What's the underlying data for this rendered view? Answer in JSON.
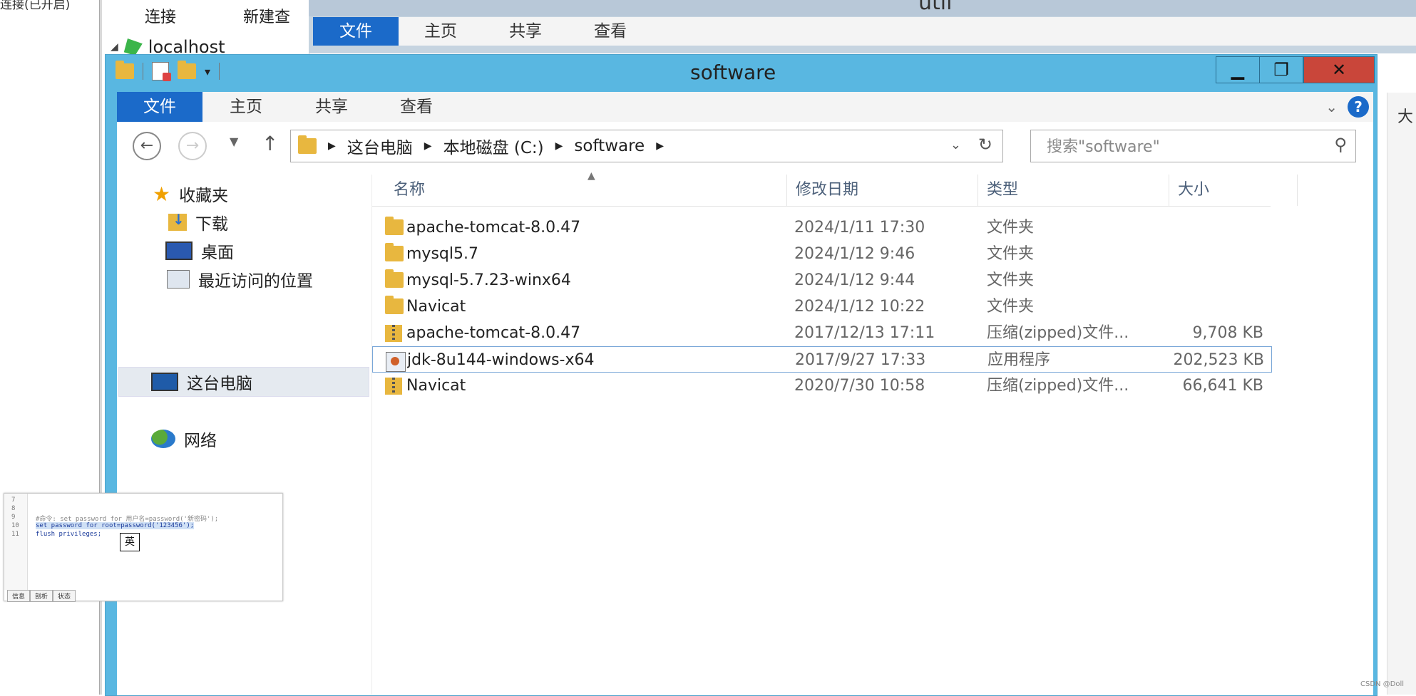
{
  "background": {
    "left_text": "连接(已开启)",
    "navicat": {
      "toolbar": [
        "连接",
        "新建查"
      ],
      "tree_root": "localhost"
    },
    "window": {
      "title": "util",
      "tabs": [
        "文件",
        "主页",
        "共享",
        "查看"
      ]
    },
    "right_edge_text": "大"
  },
  "window": {
    "title": "software",
    "controls": {
      "minimize": "▁",
      "maximize": "❐",
      "close": "✕"
    },
    "ribbon_tabs": [
      "文件",
      "主页",
      "共享",
      "查看"
    ],
    "help_glyph": "?",
    "address": {
      "crumbs": [
        "这台电脑",
        "本地磁盘 (C:)",
        "software"
      ]
    },
    "search": {
      "placeholder": "搜索\"software\""
    },
    "nav_pane": {
      "favorites": "收藏夹",
      "favorites_items": [
        "下载",
        "桌面",
        "最近访问的位置"
      ],
      "this_pc": "这台电脑",
      "network": "网络"
    },
    "columns": {
      "name": "名称",
      "date": "修改日期",
      "type": "类型",
      "size": "大小"
    },
    "files": [
      {
        "name": "apache-tomcat-8.0.47",
        "date": "2024/1/11 17:30",
        "type": "文件夹",
        "size": "",
        "icon": "folder-icon"
      },
      {
        "name": "mysql5.7",
        "date": "2024/1/12 9:46",
        "type": "文件夹",
        "size": "",
        "icon": "folder-icon"
      },
      {
        "name": "mysql-5.7.23-winx64",
        "date": "2024/1/12 9:44",
        "type": "文件夹",
        "size": "",
        "icon": "folder-icon"
      },
      {
        "name": "Navicat",
        "date": "2024/1/12 10:22",
        "type": "文件夹",
        "size": "",
        "icon": "folder-icon"
      },
      {
        "name": "apache-tomcat-8.0.47",
        "date": "2017/12/13 17:11",
        "type": "压缩(zipped)文件...",
        "size": "9,708 KB",
        "icon": "zip-icon"
      },
      {
        "name": "jdk-8u144-windows-x64",
        "date": "2017/9/27 17:33",
        "type": "应用程序",
        "size": "202,523 KB",
        "icon": "exe-icon",
        "selected": true
      },
      {
        "name": "Navicat",
        "date": "2020/7/30 10:58",
        "type": "压缩(zipped)文件...",
        "size": "66,641 KB",
        "icon": "zip-icon"
      }
    ]
  },
  "snippet": {
    "line_numbers": [
      "7",
      "8",
      "9",
      "10",
      "11"
    ],
    "comment": "#命令: set password for 用户名=password('新密码');",
    "code_line": "set password for root=password('123456');",
    "flush": "flush privileges;",
    "ime": "英",
    "tabs": [
      "信息",
      "剖析",
      "状态"
    ]
  },
  "watermark": "CSDN @Doll"
}
